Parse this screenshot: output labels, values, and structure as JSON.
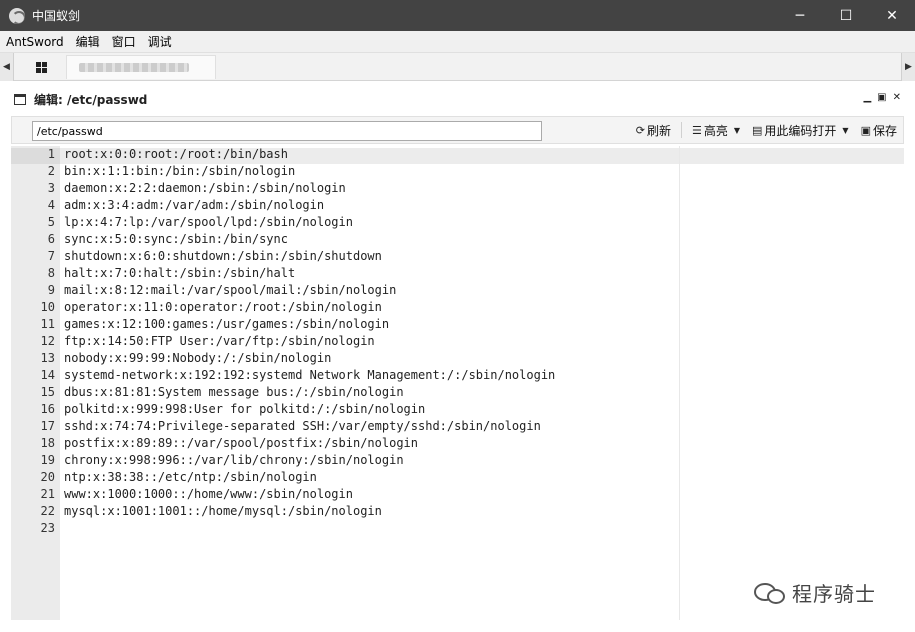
{
  "window": {
    "title": "中国蚁剑",
    "controls": {
      "minimize": "─",
      "maximize": "☐",
      "close": "✕"
    }
  },
  "menu": [
    "AntSword",
    "编辑",
    "窗口",
    "调试"
  ],
  "tabs": {
    "home_icon": "grid-icon",
    "shell_tab_label": "(blurred)"
  },
  "panel": {
    "title": "编辑: /etc/passwd",
    "controls": {
      "minimize": "▁",
      "restore": "▣",
      "close": "✕"
    }
  },
  "toolbar": {
    "path_value": "/etc/passwd",
    "refresh_label": "刷新",
    "highlight_label": "高亮",
    "encoding_label": "用此编码打开",
    "save_label": "保存"
  },
  "editor": {
    "line_numbers": [
      "1",
      "2",
      "3",
      "4",
      "5",
      "6",
      "7",
      "8",
      "9",
      "10",
      "11",
      "12",
      "13",
      "14",
      "15",
      "16",
      "17",
      "18",
      "19",
      "20",
      "21",
      "22",
      "23"
    ],
    "lines": [
      "root:x:0:0:root:/root:/bin/bash",
      "bin:x:1:1:bin:/bin:/sbin/nologin",
      "daemon:x:2:2:daemon:/sbin:/sbin/nologin",
      "adm:x:3:4:adm:/var/adm:/sbin/nologin",
      "lp:x:4:7:lp:/var/spool/lpd:/sbin/nologin",
      "sync:x:5:0:sync:/sbin:/bin/sync",
      "shutdown:x:6:0:shutdown:/sbin:/sbin/shutdown",
      "halt:x:7:0:halt:/sbin:/sbin/halt",
      "mail:x:8:12:mail:/var/spool/mail:/sbin/nologin",
      "operator:x:11:0:operator:/root:/sbin/nologin",
      "games:x:12:100:games:/usr/games:/sbin/nologin",
      "ftp:x:14:50:FTP User:/var/ftp:/sbin/nologin",
      "nobody:x:99:99:Nobody:/:/sbin/nologin",
      "systemd-network:x:192:192:systemd Network Management:/:/sbin/nologin",
      "dbus:x:81:81:System message bus:/:/sbin/nologin",
      "polkitd:x:999:998:User for polkitd:/:/sbin/nologin",
      "sshd:x:74:74:Privilege-separated SSH:/var/empty/sshd:/sbin/nologin",
      "postfix:x:89:89::/var/spool/postfix:/sbin/nologin",
      "chrony:x:998:996::/var/lib/chrony:/sbin/nologin",
      "ntp:x:38:38::/etc/ntp:/sbin/nologin",
      "www:x:1000:1000::/home/www:/sbin/nologin",
      "mysql:x:1001:1001::/home/mysql:/sbin/nologin",
      ""
    ]
  },
  "watermark": {
    "text": "程序骑士"
  }
}
